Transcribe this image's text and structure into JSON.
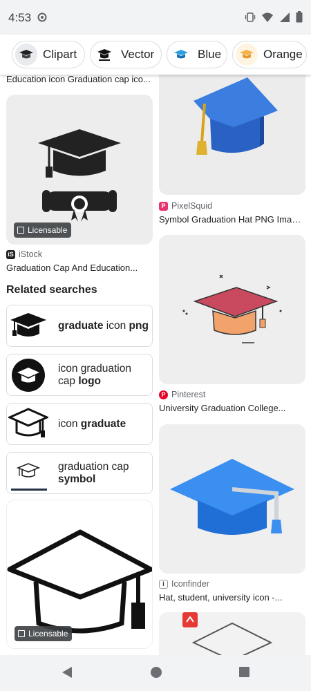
{
  "status_bar": {
    "time": "4:53"
  },
  "chips": [
    {
      "label": "Clipart"
    },
    {
      "label": "Vector"
    },
    {
      "label": "Blue"
    },
    {
      "label": "Orange"
    }
  ],
  "results": {
    "top_left_caption": "Education icon Graduation cap ico...",
    "istock": {
      "badge": "Licensable",
      "source": "iStock",
      "caption": "Graduation Cap And Education..."
    },
    "pixelsquid": {
      "source": "PixelSquid",
      "caption": "Symbol Graduation Hat PNG Image..."
    },
    "pinterest": {
      "source": "Pinterest",
      "caption": "University Graduation College..."
    },
    "iconfinder": {
      "source": "Iconfinder",
      "caption": "Hat, student, university icon -..."
    },
    "outline_cap": {
      "badge": "Licensable"
    }
  },
  "related": {
    "title": "Related searches",
    "items": [
      {
        "plain": "graduate",
        "mid": " icon ",
        "bold": "png"
      },
      {
        "line1": "icon graduation",
        "line2_plain": "cap ",
        "line2_bold": "logo"
      },
      {
        "plain": "icon ",
        "bold": "graduate"
      },
      {
        "line1": "graduation cap",
        "line2_bold": "symbol"
      }
    ]
  },
  "colors": {
    "chip_border": "#dadce0",
    "cap_blue": "#3b7ee0",
    "cap_red": "#c94a5e",
    "cap_orange": "#f2a36b",
    "pixelsquid_pink": "#e8336d",
    "pinterest_red": "#e60023"
  }
}
